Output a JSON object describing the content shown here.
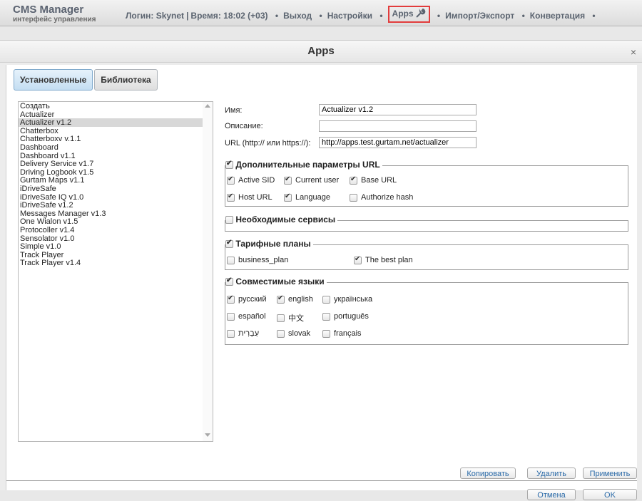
{
  "header": {
    "brand_title": "CMS Manager",
    "brand_subtitle": "интерфейс управления",
    "login": "Логин: Skynet",
    "time": "Время: 18:02 (+03)",
    "nav": [
      "Выход",
      "Настройки",
      "Apps",
      "Импорт/Экспорт",
      "Конвертация"
    ]
  },
  "dialog": {
    "title": "Apps",
    "close": "×",
    "tabs": [
      "Установленные",
      "Библиотека"
    ],
    "apps": [
      "Создать",
      "Actualizer",
      "Actualizer v1.2",
      "Chatterbox",
      "Chatterboxv v.1.1",
      "Dashboard",
      "Dashboard v1.1",
      "Delivery Service v1.7",
      "Driving Logbook v1.5",
      "Gurtam Maps v1.1",
      "iDriveSafe",
      "iDriveSafe IQ v1.0",
      "iDriveSafe v1.2",
      "Messages Manager v1.3",
      "One Wialon v1.5",
      "Protocoller v1.4",
      "Sensolator v1.0",
      "Simple v1.0",
      "Track Player",
      "Track Player v1.4"
    ],
    "selected_app": "Actualizer v1.2",
    "form": {
      "name_label": "Имя:",
      "name_value": "Actualizer v1.2",
      "desc_label": "Описание:",
      "desc_value": "",
      "url_label": "URL (http:// или https://):",
      "url_value": "http://apps.test.gurtam.net/actualizer"
    },
    "url_params": {
      "legend": "Дополнительные параметры URL",
      "checked": true,
      "active_sid": "Active SID",
      "current_user": "Current user",
      "base_url": "Base URL",
      "host_url": "Host URL",
      "language": "Language",
      "authorize_hash": "Authorize hash"
    },
    "services": {
      "legend": "Необходимые сервисы",
      "checked": false
    },
    "plans": {
      "legend": "Тарифные планы",
      "checked": true,
      "business_plan": "business_plan",
      "best_plan": "The best plan"
    },
    "languages": {
      "legend": "Совместимые языки",
      "checked": true,
      "ru": "русский",
      "en": "english",
      "uk": "українська",
      "es": "español",
      "zh": "中文",
      "pt": "português",
      "he": "עִבְרִית",
      "sk": "slovak",
      "fr": "français"
    },
    "buttons": {
      "copy": "Копировать",
      "delete": "Удалить",
      "apply": "Применить",
      "cancel": "Отмена",
      "ok": "OK"
    }
  }
}
